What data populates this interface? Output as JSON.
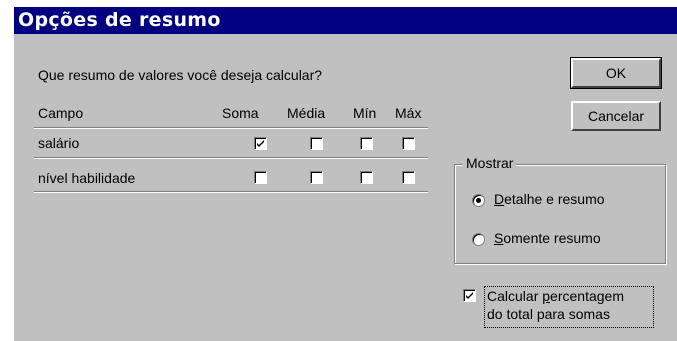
{
  "dialog": {
    "title": "Opções de resumo",
    "prompt": "Que resumo de valores você deseja calcular?"
  },
  "table": {
    "headers": {
      "field": "Campo",
      "sum": "Soma",
      "avg": "Média",
      "min": "Mín",
      "max": "Máx"
    },
    "rows": [
      {
        "field": "salário",
        "sum": true,
        "avg": false,
        "min": false,
        "max": false
      },
      {
        "field": "nível habilidade",
        "sum": false,
        "avg": false,
        "min": false,
        "max": false
      }
    ]
  },
  "buttons": {
    "ok": "OK",
    "cancel": "Cancelar"
  },
  "show_group": {
    "legend": "Mostrar",
    "options": [
      {
        "accel": "D",
        "rest": "etalhe e resumo",
        "selected": true
      },
      {
        "accel": "S",
        "rest": "omente resumo",
        "selected": false
      }
    ]
  },
  "percent_option": {
    "line1_pre": "Calcular ",
    "line1_accel": "p",
    "line1_post": "ercentagem",
    "line2": "do total para somas",
    "checked": true
  },
  "colors": {
    "titlebar": "#000080",
    "face": "#c0c0c0"
  }
}
